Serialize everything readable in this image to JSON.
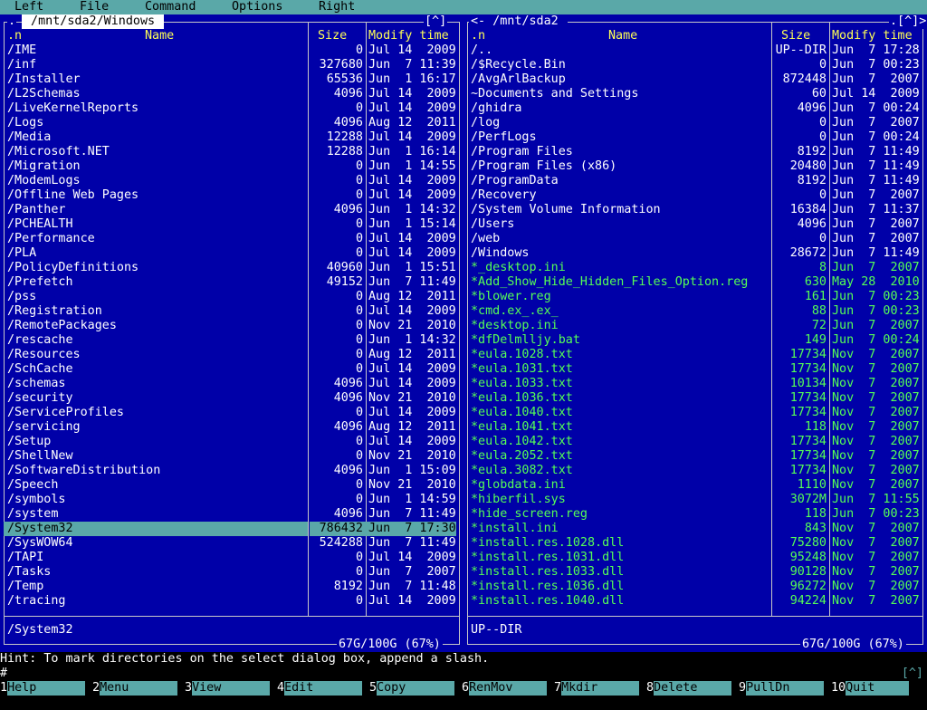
{
  "menu": [
    "Left",
    "File",
    "Command",
    "Options",
    "Right"
  ],
  "colors": {
    "panel_bg": "#0000a8",
    "accent": "#5aa8a8",
    "header": "#ffff55",
    "exe": "#55ff55"
  },
  "left_panel": {
    "title": " /mnt/sda2/Windows ",
    "button": "[^]",
    "left_button": ".",
    "headers": {
      "name": ".n",
      "name_col": "Name",
      "size": "Size",
      "mtime": "Modify time"
    },
    "rows": [
      {
        "name": "/IME",
        "size": "0",
        "mtime": "Jul 14  2009"
      },
      {
        "name": "/inf",
        "size": "327680",
        "mtime": "Jun  7 11:39"
      },
      {
        "name": "/Installer",
        "size": "65536",
        "mtime": "Jun  1 16:17"
      },
      {
        "name": "/L2Schemas",
        "size": "4096",
        "mtime": "Jul 14  2009"
      },
      {
        "name": "/LiveKernelReports",
        "size": "0",
        "mtime": "Jul 14  2009"
      },
      {
        "name": "/Logs",
        "size": "4096",
        "mtime": "Aug 12  2011"
      },
      {
        "name": "/Media",
        "size": "12288",
        "mtime": "Jul 14  2009"
      },
      {
        "name": "/Microsoft.NET",
        "size": "12288",
        "mtime": "Jun  1 16:14"
      },
      {
        "name": "/Migration",
        "size": "0",
        "mtime": "Jun  1 14:55"
      },
      {
        "name": "/ModemLogs",
        "size": "0",
        "mtime": "Jul 14  2009"
      },
      {
        "name": "/Offline Web Pages",
        "size": "0",
        "mtime": "Jul 14  2009"
      },
      {
        "name": "/Panther",
        "size": "4096",
        "mtime": "Jun  1 14:32"
      },
      {
        "name": "/PCHEALTH",
        "size": "0",
        "mtime": "Jun  1 15:14"
      },
      {
        "name": "/Performance",
        "size": "0",
        "mtime": "Jul 14  2009"
      },
      {
        "name": "/PLA",
        "size": "0",
        "mtime": "Jul 14  2009"
      },
      {
        "name": "/PolicyDefinitions",
        "size": "40960",
        "mtime": "Jun  1 15:51"
      },
      {
        "name": "/Prefetch",
        "size": "49152",
        "mtime": "Jun  7 11:49"
      },
      {
        "name": "/pss",
        "size": "0",
        "mtime": "Aug 12  2011"
      },
      {
        "name": "/Registration",
        "size": "0",
        "mtime": "Jul 14  2009"
      },
      {
        "name": "/RemotePackages",
        "size": "0",
        "mtime": "Nov 21  2010"
      },
      {
        "name": "/rescache",
        "size": "0",
        "mtime": "Jun  1 14:32"
      },
      {
        "name": "/Resources",
        "size": "0",
        "mtime": "Aug 12  2011"
      },
      {
        "name": "/SchCache",
        "size": "0",
        "mtime": "Jul 14  2009"
      },
      {
        "name": "/schemas",
        "size": "4096",
        "mtime": "Jul 14  2009"
      },
      {
        "name": "/security",
        "size": "4096",
        "mtime": "Nov 21  2010"
      },
      {
        "name": "/ServiceProfiles",
        "size": "0",
        "mtime": "Jul 14  2009"
      },
      {
        "name": "/servicing",
        "size": "4096",
        "mtime": "Aug 12  2011"
      },
      {
        "name": "/Setup",
        "size": "0",
        "mtime": "Jul 14  2009"
      },
      {
        "name": "/ShellNew",
        "size": "0",
        "mtime": "Nov 21  2010"
      },
      {
        "name": "/SoftwareDistribution",
        "size": "4096",
        "mtime": "Jun  1 15:09"
      },
      {
        "name": "/Speech",
        "size": "0",
        "mtime": "Nov 21  2010"
      },
      {
        "name": "/symbols",
        "size": "0",
        "mtime": "Jun  1 14:59"
      },
      {
        "name": "/system",
        "size": "4096",
        "mtime": "Jun  7 11:49"
      },
      {
        "name": "/System32",
        "size": "786432",
        "mtime": "Jun  7 17:30",
        "selected": true
      },
      {
        "name": "/SysWOW64",
        "size": "524288",
        "mtime": "Jun  7 11:49"
      },
      {
        "name": "/TAPI",
        "size": "0",
        "mtime": "Jul 14  2009"
      },
      {
        "name": "/Tasks",
        "size": "0",
        "mtime": "Jun  7  2007"
      },
      {
        "name": "/Temp",
        "size": "8192",
        "mtime": "Jun  7 11:48"
      },
      {
        "name": "/tracing",
        "size": "0",
        "mtime": "Jul 14  2009"
      }
    ],
    "mini_status": "/System32",
    "free_space": "67G/100G (67%)"
  },
  "right_panel": {
    "title": "<- /mnt/sda2 ",
    "button": ".[^]>",
    "headers": {
      "name": ".n",
      "name_col": "Name",
      "size": "Size",
      "mtime": "Modify time"
    },
    "rows": [
      {
        "name": "/..",
        "size": "UP--DIR",
        "mtime": "Jun  7 17:28"
      },
      {
        "name": "/$Recycle.Bin",
        "size": "0",
        "mtime": "Jun  7 00:23"
      },
      {
        "name": "/AvgArlBackup",
        "size": "872448",
        "mtime": "Jun  7  2007"
      },
      {
        "name": "~Documents and Settings",
        "size": "60",
        "mtime": "Jul 14  2009"
      },
      {
        "name": "/ghidra",
        "size": "4096",
        "mtime": "Jun  7 00:24"
      },
      {
        "name": "/log",
        "size": "0",
        "mtime": "Jun  7  2007"
      },
      {
        "name": "/PerfLogs",
        "size": "0",
        "mtime": "Jun  7 00:24"
      },
      {
        "name": "/Program Files",
        "size": "8192",
        "mtime": "Jun  7 11:49"
      },
      {
        "name": "/Program Files (x86)",
        "size": "20480",
        "mtime": "Jun  7 11:49"
      },
      {
        "name": "/ProgramData",
        "size": "8192",
        "mtime": "Jun  7 11:49"
      },
      {
        "name": "/Recovery",
        "size": "0",
        "mtime": "Jun  7  2007"
      },
      {
        "name": "/System Volume Information",
        "size": "16384",
        "mtime": "Jun  7 11:37"
      },
      {
        "name": "/Users",
        "size": "4096",
        "mtime": "Jun  7  2007"
      },
      {
        "name": "/web",
        "size": "0",
        "mtime": "Jun  7  2007"
      },
      {
        "name": "/Windows",
        "size": "28672",
        "mtime": "Jun  7 11:49"
      },
      {
        "name": "*_desktop.ini",
        "size": "8",
        "mtime": "Jun  7  2007",
        "exe": true
      },
      {
        "name": "*Add_Show_Hide_Hidden_Files_Option.reg",
        "size": "630",
        "mtime": "May 28  2010",
        "exe": true
      },
      {
        "name": "*blower.reg",
        "size": "161",
        "mtime": "Jun  7 00:23",
        "exe": true
      },
      {
        "name": "*cmd.ex_.ex_",
        "size": "88",
        "mtime": "Jun  7 00:23",
        "exe": true
      },
      {
        "name": "*desktop.ini",
        "size": "72",
        "mtime": "Jun  7  2007",
        "exe": true
      },
      {
        "name": "*dfDelmlljy.bat",
        "size": "149",
        "mtime": "Jun  7 00:24",
        "exe": true
      },
      {
        "name": "*eula.1028.txt",
        "size": "17734",
        "mtime": "Nov  7  2007",
        "exe": true
      },
      {
        "name": "*eula.1031.txt",
        "size": "17734",
        "mtime": "Nov  7  2007",
        "exe": true
      },
      {
        "name": "*eula.1033.txt",
        "size": "10134",
        "mtime": "Nov  7  2007",
        "exe": true
      },
      {
        "name": "*eula.1036.txt",
        "size": "17734",
        "mtime": "Nov  7  2007",
        "exe": true
      },
      {
        "name": "*eula.1040.txt",
        "size": "17734",
        "mtime": "Nov  7  2007",
        "exe": true
      },
      {
        "name": "*eula.1041.txt",
        "size": "118",
        "mtime": "Nov  7  2007",
        "exe": true
      },
      {
        "name": "*eula.1042.txt",
        "size": "17734",
        "mtime": "Nov  7  2007",
        "exe": true
      },
      {
        "name": "*eula.2052.txt",
        "size": "17734",
        "mtime": "Nov  7  2007",
        "exe": true
      },
      {
        "name": "*eula.3082.txt",
        "size": "17734",
        "mtime": "Nov  7  2007",
        "exe": true
      },
      {
        "name": "*globdata.ini",
        "size": "1110",
        "mtime": "Nov  7  2007",
        "exe": true
      },
      {
        "name": "*hiberfil.sys",
        "size": "3072M",
        "mtime": "Jun  7 11:55",
        "exe": true
      },
      {
        "name": "*hide_screen.reg",
        "size": "118",
        "mtime": "Jun  7 00:23",
        "exe": true
      },
      {
        "name": "*install.ini",
        "size": "843",
        "mtime": "Nov  7  2007",
        "exe": true
      },
      {
        "name": "*install.res.1028.dll",
        "size": "75280",
        "mtime": "Nov  7  2007",
        "exe": true
      },
      {
        "name": "*install.res.1031.dll",
        "size": "95248",
        "mtime": "Nov  7  2007",
        "exe": true
      },
      {
        "name": "*install.res.1033.dll",
        "size": "90128",
        "mtime": "Nov  7  2007",
        "exe": true
      },
      {
        "name": "*install.res.1036.dll",
        "size": "96272",
        "mtime": "Nov  7  2007",
        "exe": true
      },
      {
        "name": "*install.res.1040.dll",
        "size": "94224",
        "mtime": "Nov  7  2007",
        "exe": true
      }
    ],
    "mini_status": "UP--DIR",
    "free_space": "67G/100G (67%)"
  },
  "hint": "Hint: To mark directories on the select dialog box, append a slash.",
  "cmdline": {
    "prompt": "#",
    "history": "[^]"
  },
  "fkeys": [
    {
      "num": "1",
      "label": "Help"
    },
    {
      "num": "2",
      "label": "Menu"
    },
    {
      "num": "3",
      "label": "View"
    },
    {
      "num": "4",
      "label": "Edit"
    },
    {
      "num": "5",
      "label": "Copy"
    },
    {
      "num": "6",
      "label": "RenMov"
    },
    {
      "num": "7",
      "label": "Mkdir"
    },
    {
      "num": "8",
      "label": "Delete"
    },
    {
      "num": "9",
      "label": "PullDn"
    },
    {
      "num": "10",
      "label": "Quit"
    }
  ]
}
